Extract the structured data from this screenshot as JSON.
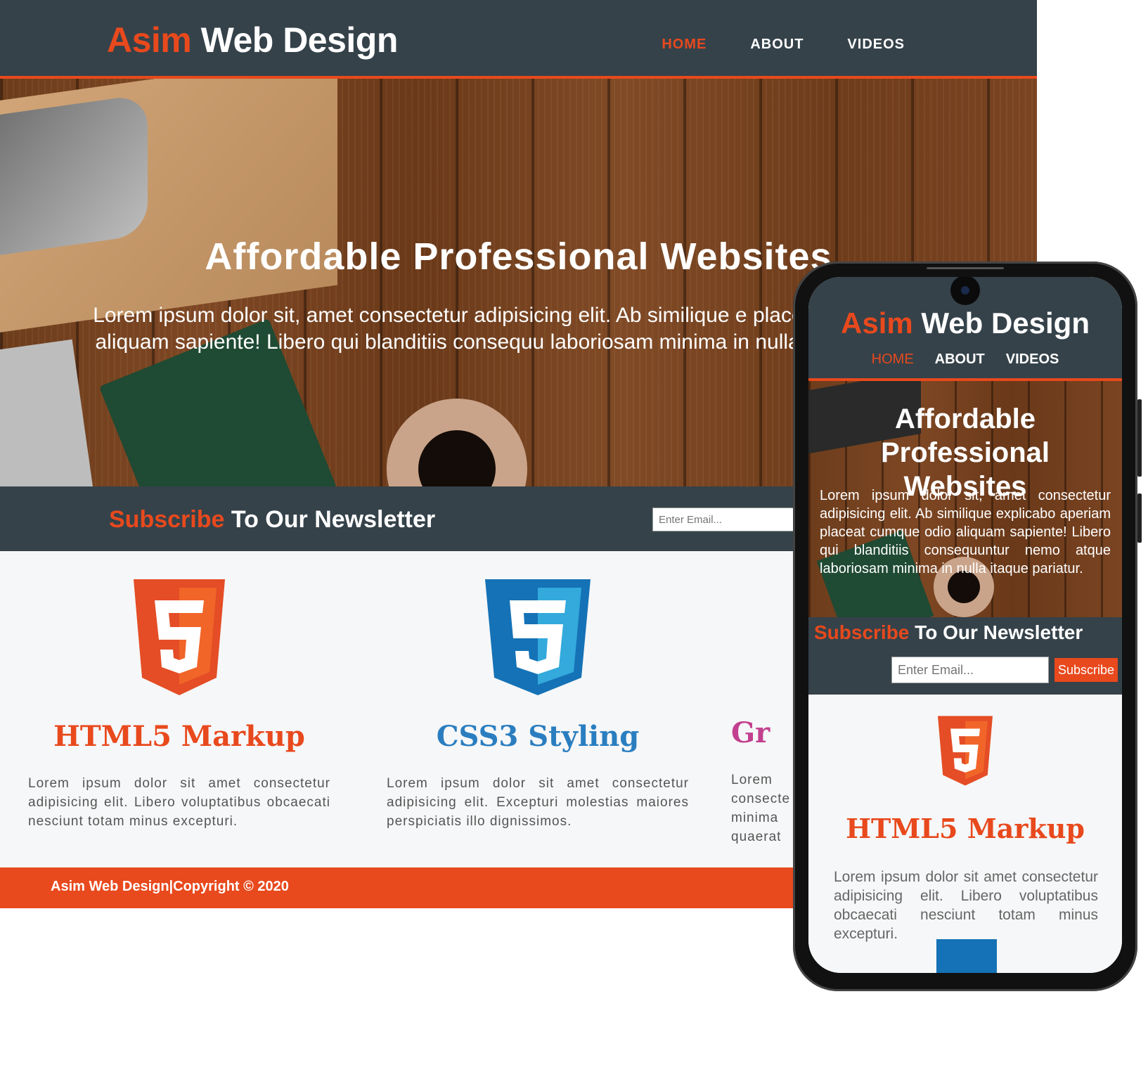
{
  "colors": {
    "accent": "#e8491d",
    "dark": "#35424a",
    "html5": "#e44d26",
    "css3": "#1572b6",
    "graphics": "#c2408f"
  },
  "desktop": {
    "brand_highlight": "Asim",
    "brand_rest": " Web Design",
    "nav": [
      "HOME",
      "ABOUT",
      "VIDEOS"
    ],
    "hero_title": "Affordable Professional Websites",
    "hero_text": "Lorem ipsum dolor sit, amet consectetur adipisicing elit. Ab similique e placeat cumque odio aliquam sapiente! Libero qui blanditiis consequu laboriosam minima in nulla itaque pariatur.",
    "newsletter_highlight": "Subscribe",
    "newsletter_rest": " To Our Newsletter",
    "email_placeholder": "Enter Email...",
    "boxes": [
      {
        "icon": "html5-logo-icon",
        "title": "HTML5 Markup",
        "text": "Lorem ipsum dolor sit amet consectetur adipisicing elit. Libero voluptatibus obcaecati nesciunt totam minus excepturi."
      },
      {
        "icon": "css3-logo-icon",
        "title": "CSS3 Styling",
        "text": "Lorem ipsum dolor sit amet consectetur adipisicing elit. Excepturi molestias maiores perspiciatis illo dignissimos."
      },
      {
        "icon": "graphics-logo-icon",
        "title": "Gr",
        "text": "Lorem consecte minima quaerat"
      }
    ],
    "footer": "Asim Web Design|Copyright © 2020"
  },
  "mobile": {
    "brand_highlight": "Asim",
    "brand_rest": " Web Design",
    "nav": [
      "HOME",
      "ABOUT",
      "VIDEOS"
    ],
    "hero_title": "Affordable Professional Websites",
    "hero_text": "Lorem ipsum dolor sit, amet consectetur adipisicing elit. Ab similique explicabo aperiam placeat cumque odio aliquam sapiente! Libero qui blanditiis consequuntur nemo atque laboriosam minima in nulla itaque pariatur.",
    "newsletter_highlight": "Subscribe",
    "newsletter_rest": " To Our Newsletter",
    "email_placeholder": "Enter Email...",
    "subscribe_button": "Subscribe",
    "box_title": "HTML5 Markup",
    "box_text": "Lorem ipsum dolor sit amet consectetur adipisicing elit. Libero voluptatibus obcaecati nesciunt totam minus excepturi."
  }
}
